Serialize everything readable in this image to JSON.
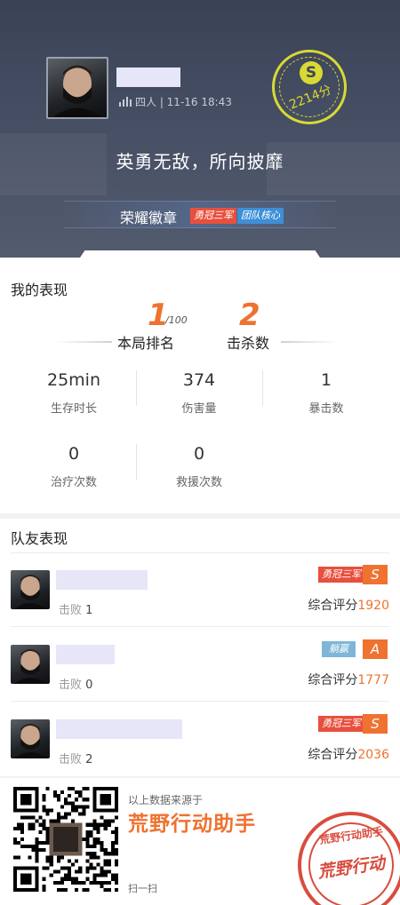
{
  "header": {
    "player_meta": "四人 | 11-16 18:43",
    "grade": "S",
    "score": "2214分",
    "slogan": "英勇无敌，所向披靡",
    "badges_label": "荣耀徽章",
    "badges": [
      "勇冠三军",
      "团队核心"
    ],
    "colors": {
      "accent": "#ef7230",
      "stamp": "#d9d934",
      "header_bg": "#454e63"
    }
  },
  "my_performance": {
    "title": "我的表现",
    "rank": "1",
    "rank_total": "/100",
    "rank_label": "本局排名",
    "kills": "2",
    "kills_label": "击杀数",
    "stats": [
      {
        "value": "25min",
        "label": "生存时长"
      },
      {
        "value": "374",
        "label": "伤害量"
      },
      {
        "value": "1",
        "label": "暴击数"
      },
      {
        "value": "0",
        "label": "治疗次数"
      },
      {
        "value": "0",
        "label": "救援次数"
      }
    ]
  },
  "teammates": {
    "title": "队友表现",
    "defeat_label": "击败",
    "overall_label": "综合评分",
    "rows": [
      {
        "defeats": "1",
        "tag": "勇冠三军",
        "grade": "S",
        "score": "1920"
      },
      {
        "defeats": "0",
        "tag": "躺赢",
        "grade": "A",
        "score": "1777"
      },
      {
        "defeats": "2",
        "tag": "勇冠三军",
        "grade": "S",
        "score": "2036"
      }
    ]
  },
  "footer": {
    "source": "以上数据来源于",
    "app_name": "荒野行动助手",
    "scan": "扫一扫",
    "seal_top": "荒野行动助手",
    "seal_mid": "荒野行动"
  }
}
